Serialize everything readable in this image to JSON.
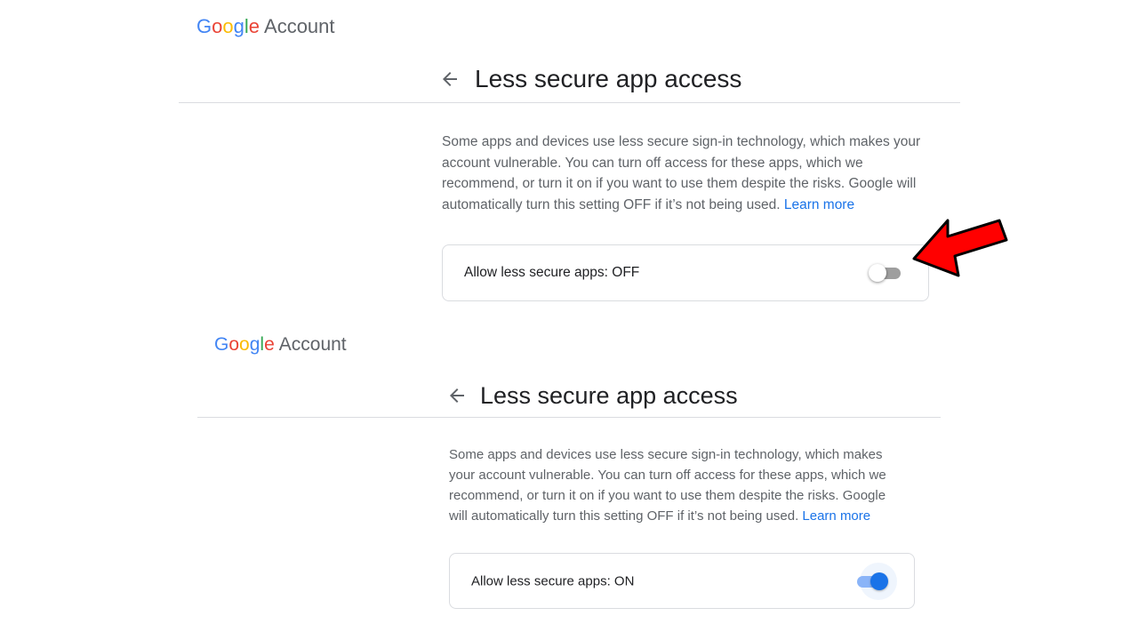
{
  "screens": [
    {
      "logo": {
        "brand": "Google",
        "suffix": "Account"
      },
      "title": "Less secure app access",
      "description": "Some apps and devices use less secure sign-in technology, which makes your account vulnerable. You can turn off access for these apps, which we recommend, or turn it on if you want to use them despite the risks. Google will automatically turn this setting OFF if it’s not being used.",
      "learn_more": "Learn more",
      "setting_label": "Allow less secure apps: OFF",
      "toggle_state": "off"
    },
    {
      "logo": {
        "brand": "Google",
        "suffix": "Account"
      },
      "title": "Less secure app access",
      "description": "Some apps and devices use less secure sign-in technology, which makes your account vulnerable. You can turn off access for these apps, which we recommend, or turn it on if you want to use them despite the risks. Google will automatically turn this setting OFF if it’s not being used.",
      "learn_more": "Learn more",
      "setting_label": "Allow less secure apps: ON",
      "toggle_state": "on"
    }
  ],
  "colors": {
    "google_blue": "#4285F4",
    "google_red": "#EA4335",
    "google_yellow": "#FBBC05",
    "google_green": "#34A853",
    "link": "#1a73e8",
    "annotation_arrow": "#ff0000"
  },
  "icons": {
    "back": "arrow-back-icon",
    "annotation": "red-pointer-arrow-icon"
  }
}
